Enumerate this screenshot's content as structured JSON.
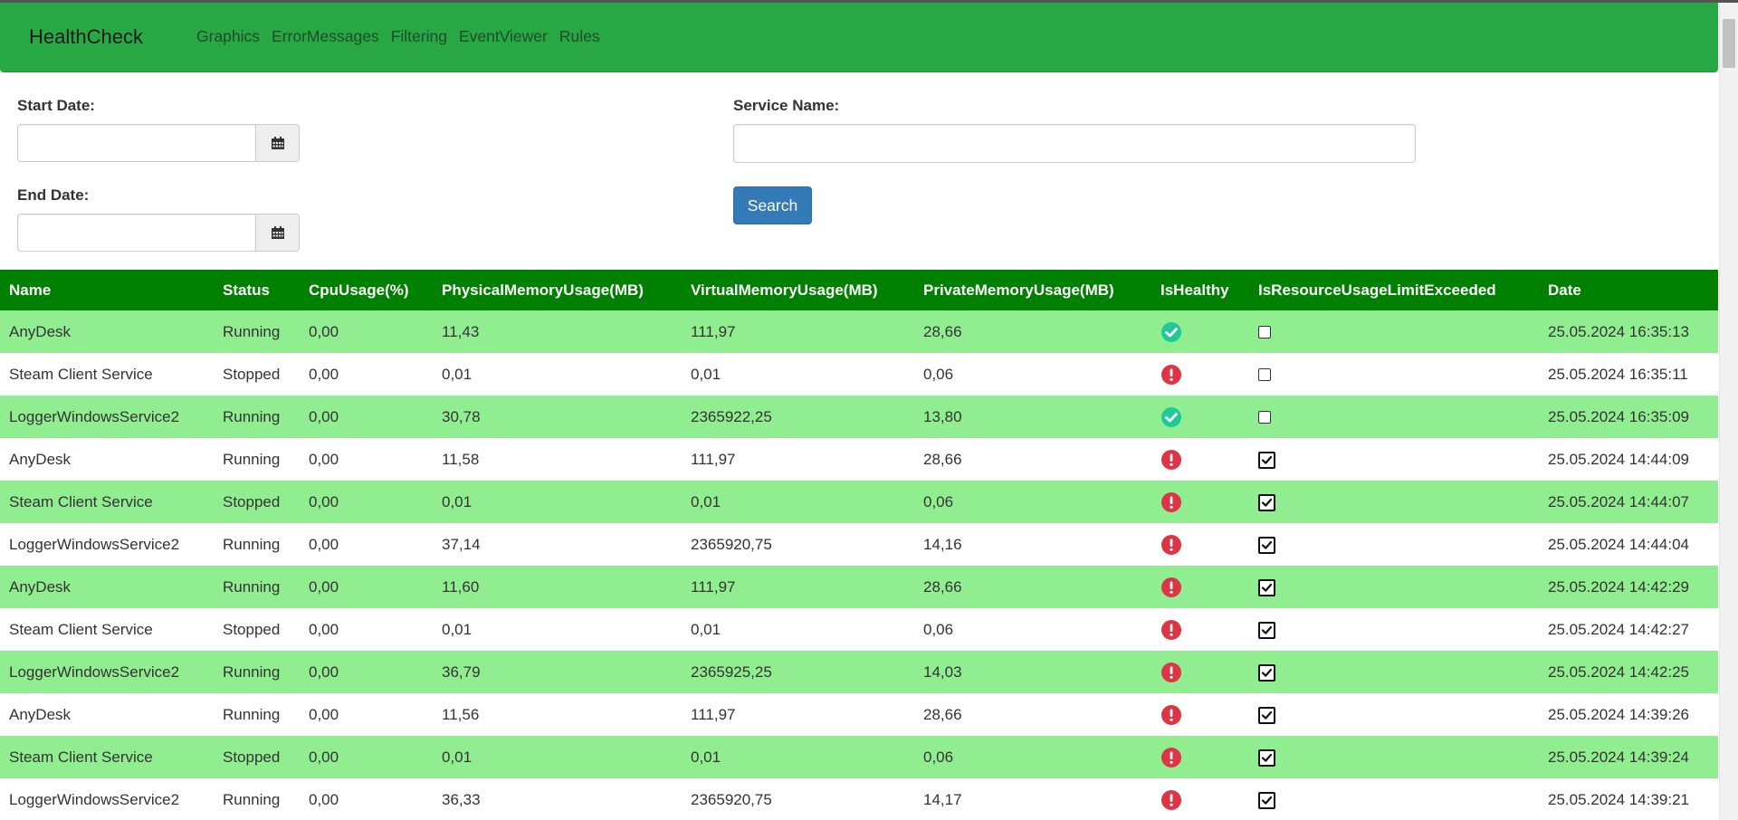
{
  "navbar": {
    "brand": "HealthCheck",
    "links": [
      "Graphics",
      "ErrorMessages",
      "Filtering",
      "EventViewer",
      "Rules"
    ]
  },
  "form": {
    "start_date_label": "Start Date:",
    "start_date_value": "",
    "end_date_label": "End Date:",
    "end_date_value": "",
    "service_name_label": "Service Name:",
    "service_name_value": "",
    "search_button": "Search",
    "calendar_icon": "calendar-icon"
  },
  "table": {
    "headers": [
      "Name",
      "Status",
      "CpuUsage(%)",
      "PhysicalMemoryUsage(MB)",
      "VirtualMemoryUsage(MB)",
      "PrivateMemoryUsage(MB)",
      "IsHealthy",
      "IsResourceUsageLimitExceeded",
      "Date"
    ],
    "rows": [
      {
        "name": "AnyDesk",
        "status": "Running",
        "cpu": "0,00",
        "physical": "11,43",
        "virtual": "111,97",
        "private": "28,66",
        "healthy": true,
        "exceeded": false,
        "date": "25.05.2024 16:35:13"
      },
      {
        "name": "Steam Client Service",
        "status": "Stopped",
        "cpu": "0,00",
        "physical": "0,01",
        "virtual": "0,01",
        "private": "0,06",
        "healthy": false,
        "exceeded": false,
        "date": "25.05.2024 16:35:11"
      },
      {
        "name": "LoggerWindowsService2",
        "status": "Running",
        "cpu": "0,00",
        "physical": "30,78",
        "virtual": "2365922,25",
        "private": "13,80",
        "healthy": true,
        "exceeded": false,
        "date": "25.05.2024 16:35:09"
      },
      {
        "name": "AnyDesk",
        "status": "Running",
        "cpu": "0,00",
        "physical": "11,58",
        "virtual": "111,97",
        "private": "28,66",
        "healthy": false,
        "exceeded": true,
        "date": "25.05.2024 14:44:09"
      },
      {
        "name": "Steam Client Service",
        "status": "Stopped",
        "cpu": "0,00",
        "physical": "0,01",
        "virtual": "0,01",
        "private": "0,06",
        "healthy": false,
        "exceeded": true,
        "date": "25.05.2024 14:44:07"
      },
      {
        "name": "LoggerWindowsService2",
        "status": "Running",
        "cpu": "0,00",
        "physical": "37,14",
        "virtual": "2365920,75",
        "private": "14,16",
        "healthy": false,
        "exceeded": true,
        "date": "25.05.2024 14:44:04"
      },
      {
        "name": "AnyDesk",
        "status": "Running",
        "cpu": "0,00",
        "physical": "11,60",
        "virtual": "111,97",
        "private": "28,66",
        "healthy": false,
        "exceeded": true,
        "date": "25.05.2024 14:42:29"
      },
      {
        "name": "Steam Client Service",
        "status": "Stopped",
        "cpu": "0,00",
        "physical": "0,01",
        "virtual": "0,01",
        "private": "0,06",
        "healthy": false,
        "exceeded": true,
        "date": "25.05.2024 14:42:27"
      },
      {
        "name": "LoggerWindowsService2",
        "status": "Running",
        "cpu": "0,00",
        "physical": "36,79",
        "virtual": "2365925,25",
        "private": "14,03",
        "healthy": false,
        "exceeded": true,
        "date": "25.05.2024 14:42:25"
      },
      {
        "name": "AnyDesk",
        "status": "Running",
        "cpu": "0,00",
        "physical": "11,56",
        "virtual": "111,97",
        "private": "28,66",
        "healthy": false,
        "exceeded": true,
        "date": "25.05.2024 14:39:26"
      },
      {
        "name": "Steam Client Service",
        "status": "Stopped",
        "cpu": "0,00",
        "physical": "0,01",
        "virtual": "0,01",
        "private": "0,06",
        "healthy": false,
        "exceeded": true,
        "date": "25.05.2024 14:39:24"
      },
      {
        "name": "LoggerWindowsService2",
        "status": "Running",
        "cpu": "0,00",
        "physical": "36,33",
        "virtual": "2365920,75",
        "private": "14,17",
        "healthy": false,
        "exceeded": true,
        "date": "25.05.2024 14:39:21"
      }
    ]
  },
  "icons": {
    "healthy": "check-circle-icon",
    "unhealthy": "exclamation-circle-icon",
    "checked": "checked-checkbox-icon",
    "unchecked": "unchecked-checkbox-icon"
  },
  "colors": {
    "navbar": "#28a745",
    "table_header": "#008000",
    "row_highlight": "#90ee90",
    "primary_button": "#337ab7",
    "healthy_icon": "#20c997",
    "unhealthy_icon": "#dc3545"
  }
}
